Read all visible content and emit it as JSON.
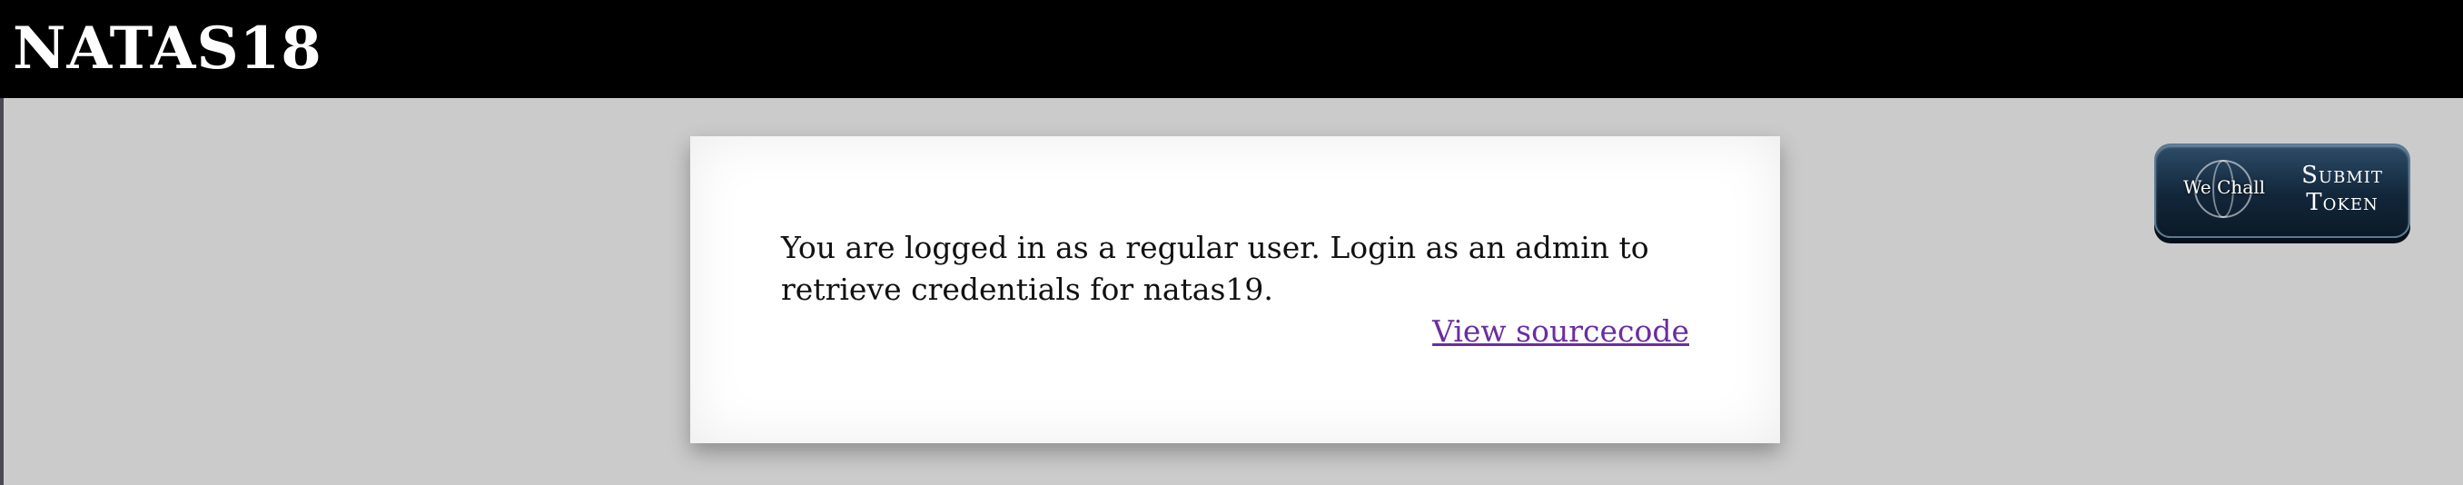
{
  "header": {
    "title": "NATAS18"
  },
  "content": {
    "message": "You are logged in as a regular user. Login as an admin to retrieve credentials for natas19.",
    "link_label": "View sourcecode"
  },
  "token_button": {
    "logo_text": "We Chall",
    "label_line1": "Submit",
    "label_line2": "Token"
  },
  "colors": {
    "header_bg": "#000000",
    "page_bg": "#cbcbcb",
    "link": "#6a2ea0",
    "button_bg": "#12263a"
  }
}
